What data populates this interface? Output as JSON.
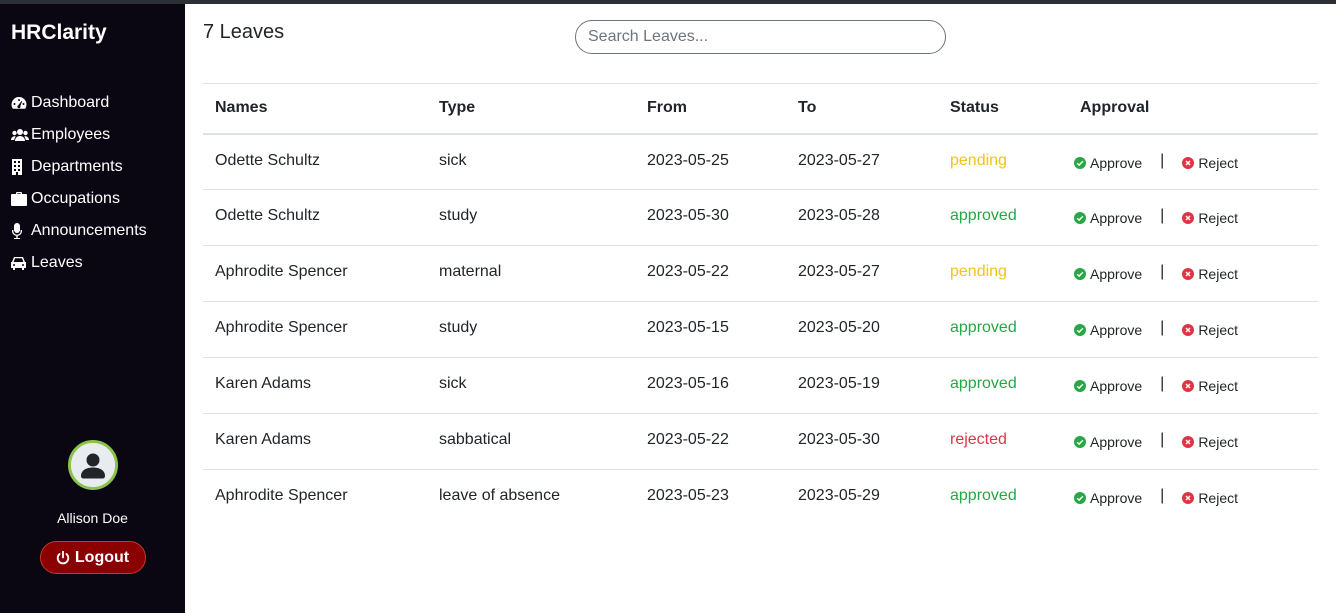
{
  "app": {
    "brand": "HRClarity"
  },
  "sidebar": {
    "items": [
      {
        "label": "Dashboard",
        "icon": "tachometer-icon"
      },
      {
        "label": "Employees",
        "icon": "users-icon"
      },
      {
        "label": "Departments",
        "icon": "building-icon"
      },
      {
        "label": "Occupations",
        "icon": "briefcase-icon"
      },
      {
        "label": "Announcements",
        "icon": "microphone-icon"
      },
      {
        "label": "Leaves",
        "icon": "car-icon"
      }
    ],
    "user": {
      "name": "Allison Doe",
      "avatar_border": "#8bc34a"
    },
    "logout_label": "Logout"
  },
  "main": {
    "title": "7 Leaves",
    "search_placeholder": "Search Leaves...",
    "columns": [
      "Names",
      "Type",
      "From",
      "To",
      "Status",
      "Approval"
    ],
    "approve_label": "Approve",
    "reject_label": "Reject",
    "rows": [
      {
        "name": "Odette Schultz",
        "type": "sick",
        "from": "2023-05-25",
        "to": "2023-05-27",
        "status": "pending"
      },
      {
        "name": "Odette Schultz",
        "type": "study",
        "from": "2023-05-30",
        "to": "2023-05-28",
        "status": "approved"
      },
      {
        "name": "Aphrodite Spencer",
        "type": "maternal",
        "from": "2023-05-22",
        "to": "2023-05-27",
        "status": "pending"
      },
      {
        "name": "Aphrodite Spencer",
        "type": "study",
        "from": "2023-05-15",
        "to": "2023-05-20",
        "status": "approved"
      },
      {
        "name": "Karen Adams",
        "type": "sick",
        "from": "2023-05-16",
        "to": "2023-05-19",
        "status": "approved"
      },
      {
        "name": "Karen Adams",
        "type": "sabbatical",
        "from": "2023-05-22",
        "to": "2023-05-30",
        "status": "rejected"
      },
      {
        "name": "Aphrodite Spencer",
        "type": "leave of absence",
        "from": "2023-05-23",
        "to": "2023-05-29",
        "status": "approved"
      }
    ]
  },
  "colors": {
    "sidebar_bg": "#0a0712",
    "pending": "#f0c419",
    "approved": "#28a745",
    "rejected": "#dc3545",
    "logout_bg": "#8b0000"
  }
}
